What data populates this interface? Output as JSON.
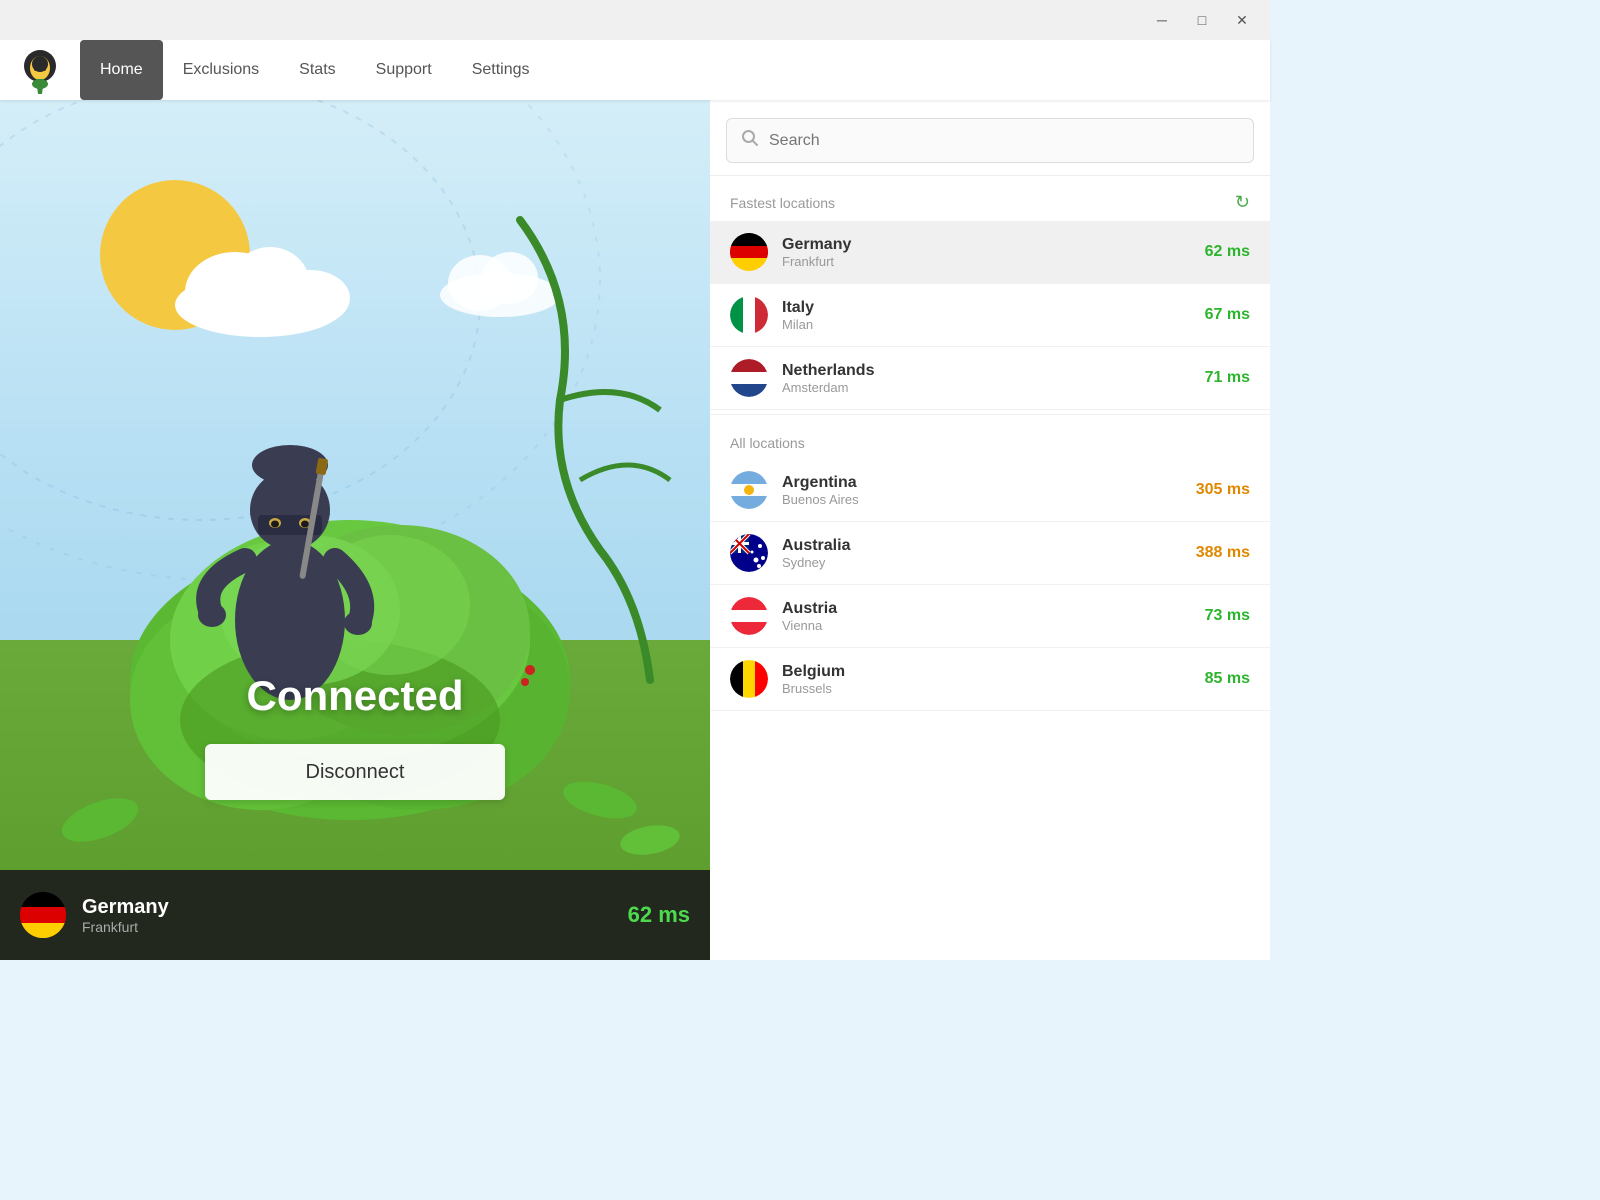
{
  "window": {
    "minimize_label": "─",
    "maximize_label": "□",
    "close_label": "✕"
  },
  "nav": {
    "tabs": [
      {
        "id": "home",
        "label": "Home",
        "active": true
      },
      {
        "id": "exclusions",
        "label": "Exclusions",
        "active": false
      },
      {
        "id": "stats",
        "label": "Stats",
        "active": false
      },
      {
        "id": "support",
        "label": "Support",
        "active": false
      },
      {
        "id": "settings",
        "label": "Settings",
        "active": false
      }
    ]
  },
  "vpn": {
    "status": "Connected",
    "disconnect_label": "Disconnect",
    "current_country": "Germany",
    "current_city": "Frankfurt",
    "current_latency": "62 ms"
  },
  "search": {
    "placeholder": "Search"
  },
  "fastest_locations": {
    "title": "Fastest locations",
    "items": [
      {
        "country": "Germany",
        "city": "Frankfurt",
        "latency": "62 ms",
        "latency_type": "green",
        "flag": "de",
        "selected": true
      },
      {
        "country": "Italy",
        "city": "Milan",
        "latency": "67 ms",
        "latency_type": "green",
        "flag": "it",
        "selected": false
      },
      {
        "country": "Netherlands",
        "city": "Amsterdam",
        "latency": "71 ms",
        "latency_type": "green",
        "flag": "nl",
        "selected": false
      }
    ]
  },
  "all_locations": {
    "title": "All locations",
    "items": [
      {
        "country": "Argentina",
        "city": "Buenos Aires",
        "latency": "305 ms",
        "latency_type": "orange",
        "flag": "ar"
      },
      {
        "country": "Australia",
        "city": "Sydney",
        "latency": "388 ms",
        "latency_type": "orange",
        "flag": "au"
      },
      {
        "country": "Austria",
        "city": "Vienna",
        "latency": "73 ms",
        "latency_type": "green",
        "flag": "at"
      },
      {
        "country": "Belgium",
        "city": "Brussels",
        "latency": "85 ms",
        "latency_type": "green",
        "flag": "be"
      }
    ]
  }
}
